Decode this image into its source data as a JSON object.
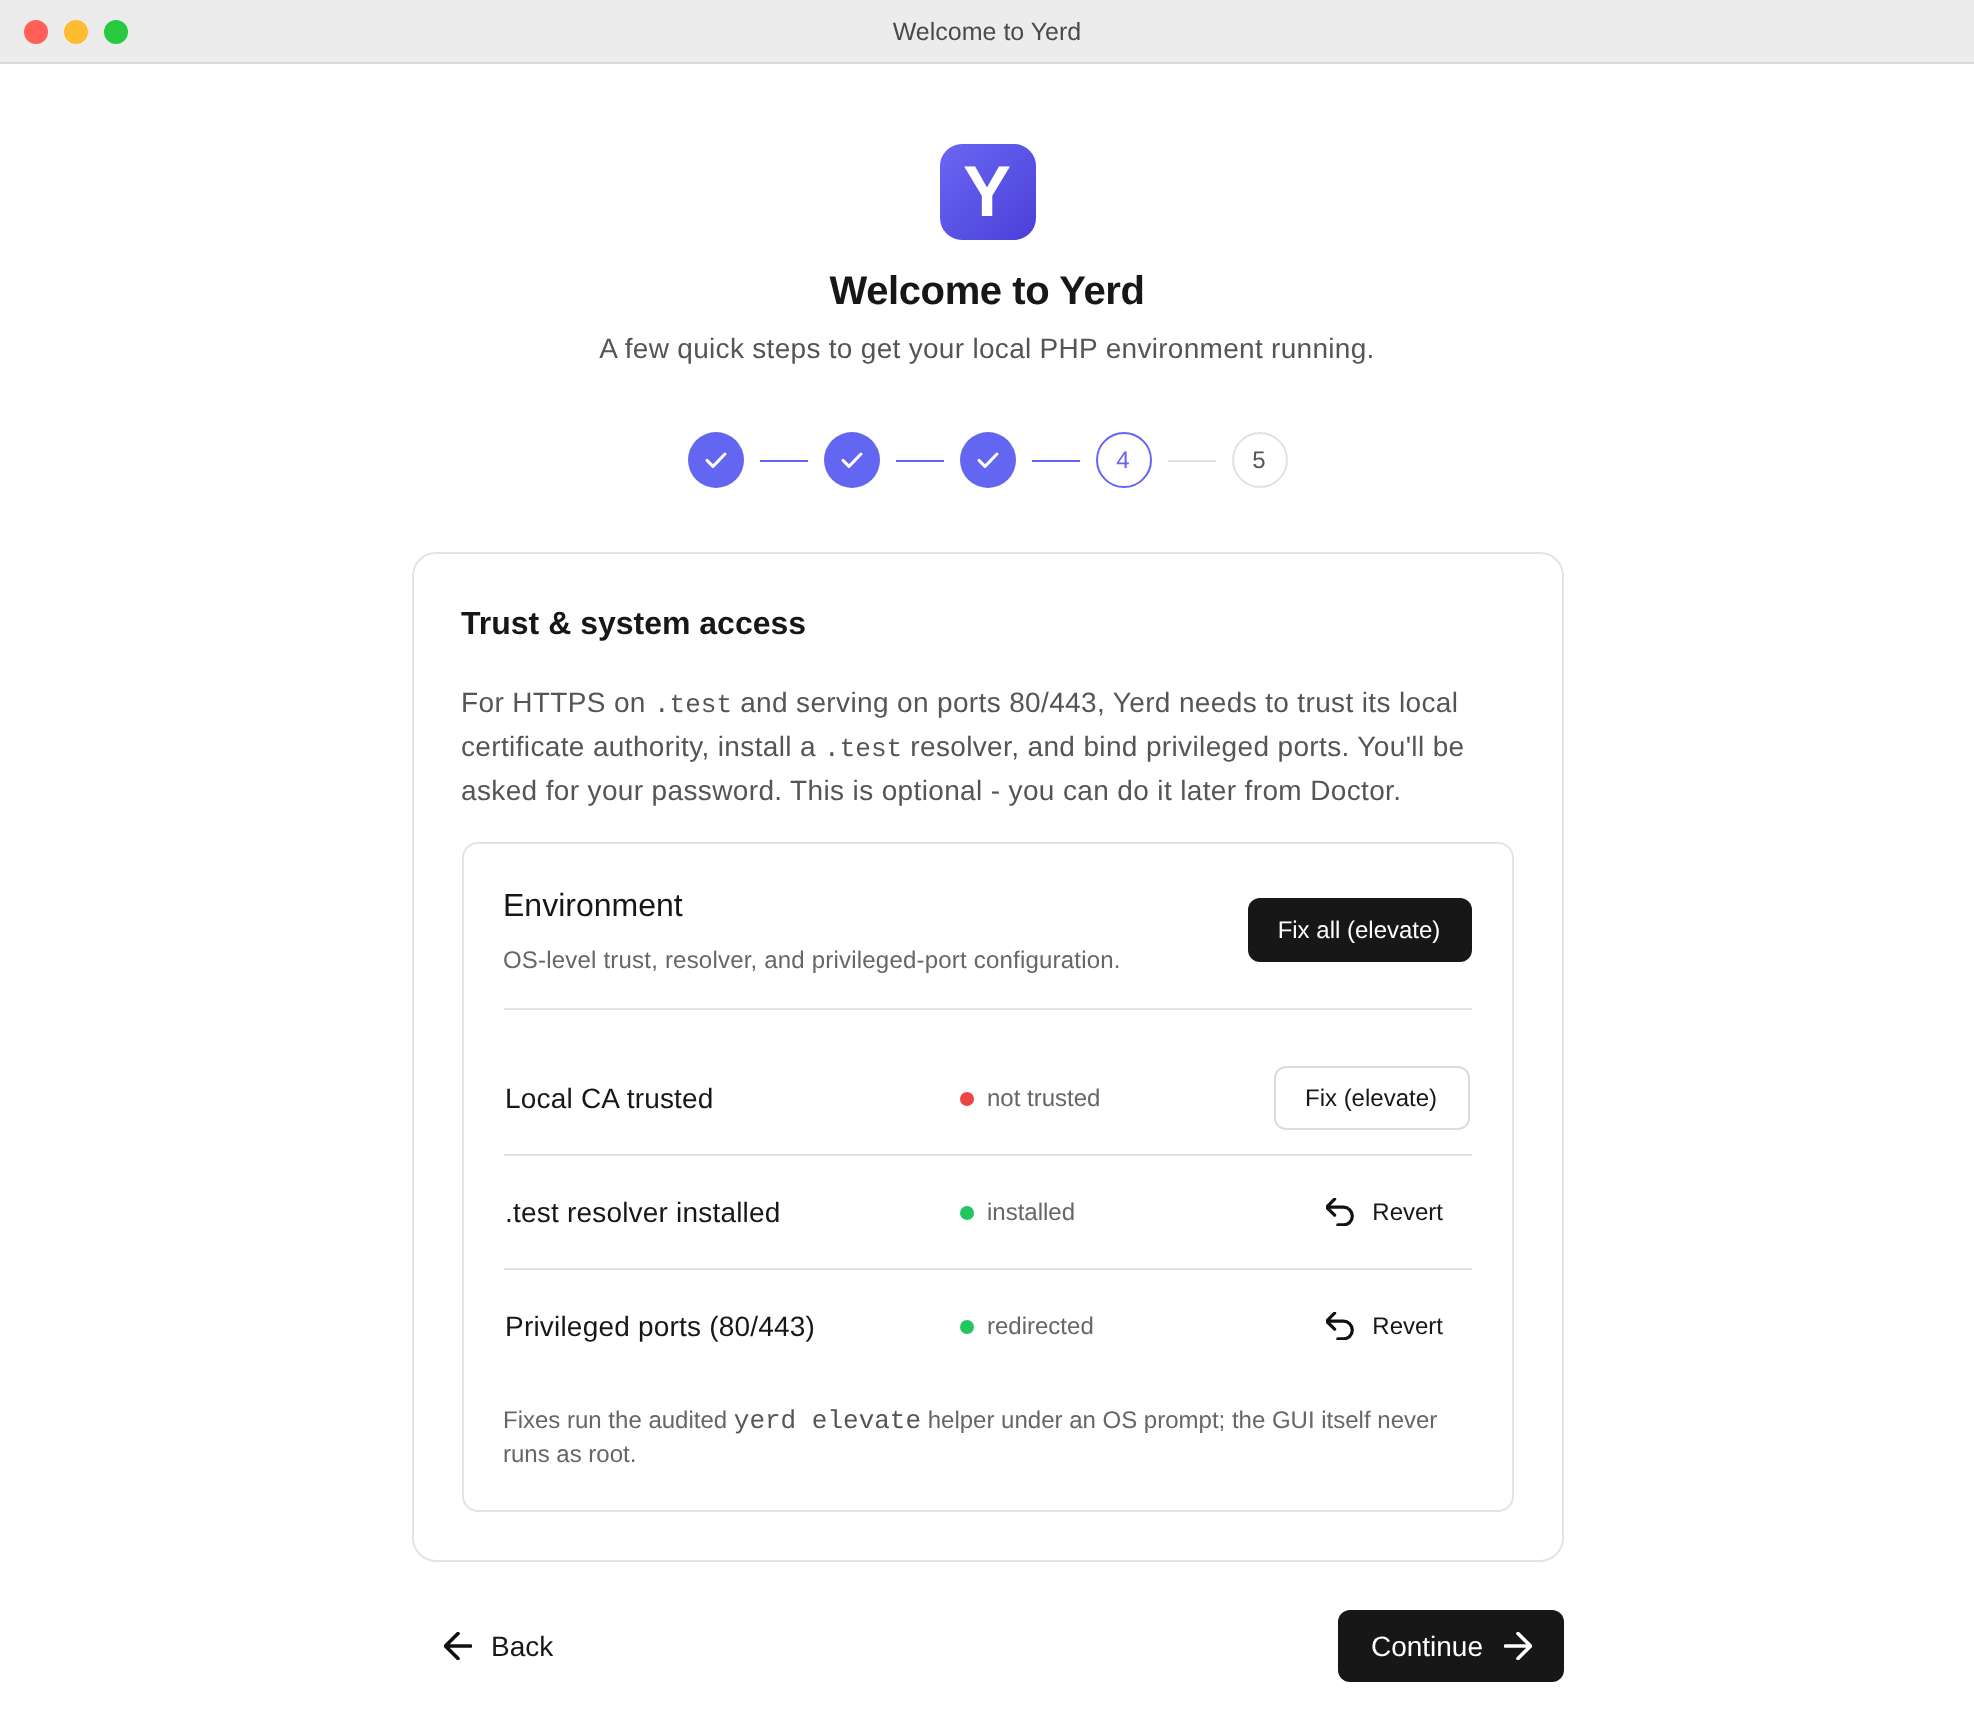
{
  "window": {
    "title": "Welcome to Yerd"
  },
  "header": {
    "logo_letter": "Y",
    "title": "Welcome to Yerd",
    "subtitle": "A few quick steps to get your local PHP environment running."
  },
  "steps": [
    {
      "kind": "done"
    },
    {
      "kind": "done"
    },
    {
      "kind": "done"
    },
    {
      "kind": "current",
      "label": "4"
    },
    {
      "kind": "upcoming",
      "label": "5"
    }
  ],
  "card": {
    "title": "Trust & system access",
    "description": [
      {
        "kind": "text",
        "text": "For HTTPS on "
      },
      {
        "kind": "code",
        "text": ".test"
      },
      {
        "kind": "text",
        "text": " and serving on ports 80/443, Yerd needs to trust its local certificate authority, install a "
      },
      {
        "kind": "code",
        "text": ".test"
      },
      {
        "kind": "text",
        "text": " resolver, and bind privileged ports. You'll be asked for your password. This is optional - you can do it later from Doctor."
      }
    ],
    "environment": {
      "title": "Environment",
      "subtitle": "OS-level trust, resolver, and privileged-port configuration.",
      "fix_all_button": "Fix all (elevate)",
      "checks": [
        {
          "label": "Local CA trusted",
          "status": "not trusted",
          "color": "#ef4444",
          "action": {
            "kind": "fix",
            "label": "Fix (elevate)"
          }
        },
        {
          "label": ".test resolver installed",
          "status": "installed",
          "color": "#22c55e",
          "action": {
            "kind": "revert",
            "label": "Revert"
          }
        },
        {
          "label": "Privileged ports (80/443)",
          "status": "redirected",
          "color": "#22c55e",
          "action": {
            "kind": "revert",
            "label": "Revert"
          }
        }
      ],
      "note": [
        {
          "kind": "text",
          "text": "Fixes run the audited "
        },
        {
          "kind": "code",
          "text": "yerd elevate"
        },
        {
          "kind": "text",
          "text": " helper under an OS prompt; the GUI itself never runs as root."
        }
      ]
    }
  },
  "footer": {
    "back_button": "Back",
    "continue_button": "Continue"
  }
}
